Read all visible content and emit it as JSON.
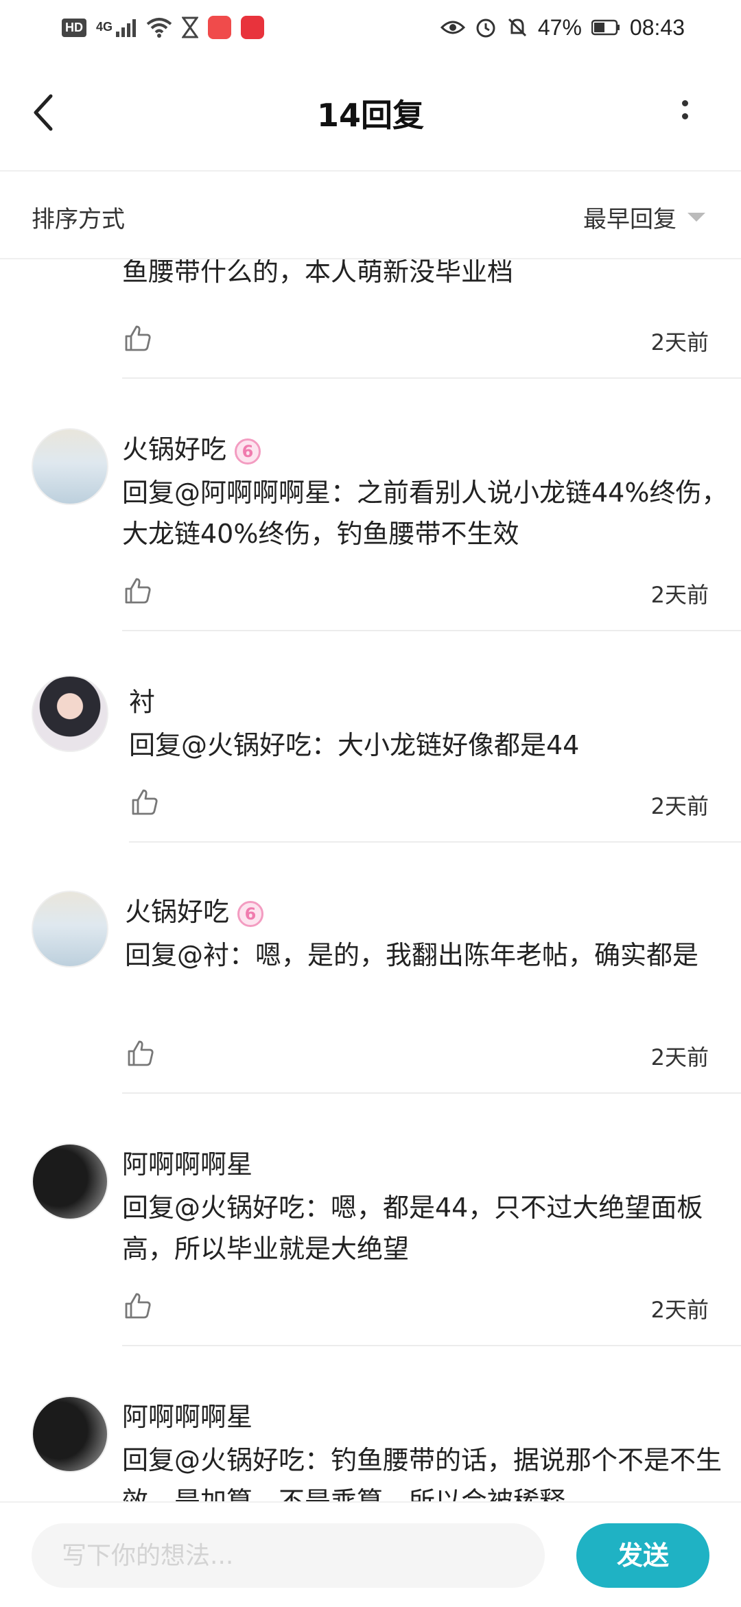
{
  "status_bar": {
    "signal": "4G",
    "battery": "47%",
    "time": "08:43"
  },
  "header": {
    "title": "14回复"
  },
  "sort": {
    "label": "排序方式",
    "selected": "最早回复"
  },
  "replies": [
    {
      "username": "",
      "text": "鱼腰带什么的，本人萌新没毕业档",
      "time": "2天前"
    },
    {
      "username": "火锅好吃",
      "level": "6",
      "text": "回复@阿啊啊啊星：之前看别人说小龙链44%终伤，大龙链40%终伤，钓鱼腰带不生效",
      "time": "2天前"
    },
    {
      "username": "衬",
      "text": "回复@火锅好吃：大小龙链好像都是44",
      "time": "2天前"
    },
    {
      "username": "火锅好吃",
      "level": "6",
      "text": "回复@衬：嗯，是的，我翻出陈年老帖，确实都是",
      "time": "2天前"
    },
    {
      "username": "阿啊啊啊星",
      "text": "回复@火锅好吃：嗯，都是44，只不过大绝望面板高，所以毕业就是大绝望",
      "time": "2天前"
    },
    {
      "username": "阿啊啊啊星",
      "text": "回复@火锅好吃：钓鱼腰带的话，据说那个不是不生效，是加算，不是乘算，所以会被稀释"
    }
  ],
  "composer": {
    "placeholder": "写下你的想法...",
    "send_label": "发送"
  }
}
